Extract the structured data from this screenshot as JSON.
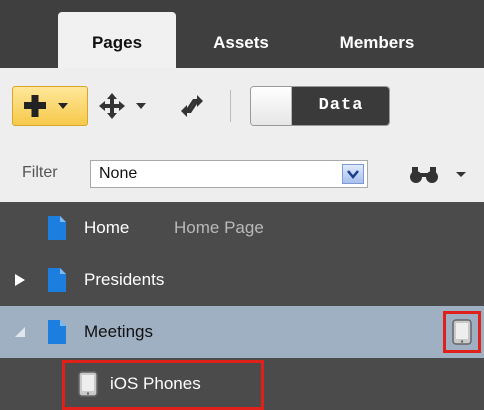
{
  "tabs": [
    {
      "label": "Pages",
      "active": true
    },
    {
      "label": "Assets",
      "active": false
    },
    {
      "label": "Members",
      "active": false
    }
  ],
  "toolbar": {
    "add_icon": "plus-icon",
    "move_icon": "move-arrows-icon",
    "refresh_icon": "refresh-icon",
    "data_toggle_label": "Data"
  },
  "filter": {
    "label": "Filter",
    "selected_value": "None"
  },
  "tree": [
    {
      "label": "Home",
      "sublabel": "Home Page",
      "expand": "none",
      "selected": false
    },
    {
      "label": "Presidents",
      "sublabel": "",
      "expand": "collapsed",
      "selected": false
    },
    {
      "label": "Meetings",
      "sublabel": "",
      "expand": "expanded",
      "selected": true
    },
    {
      "label": "iOS Phones",
      "sublabel": "",
      "expand": "none",
      "selected": false
    }
  ],
  "colors": {
    "highlight_border": "#e0201a",
    "selected_row": "#9fb0c3",
    "add_button": "#f6c94b",
    "page_icon": "#1c7fe0"
  }
}
